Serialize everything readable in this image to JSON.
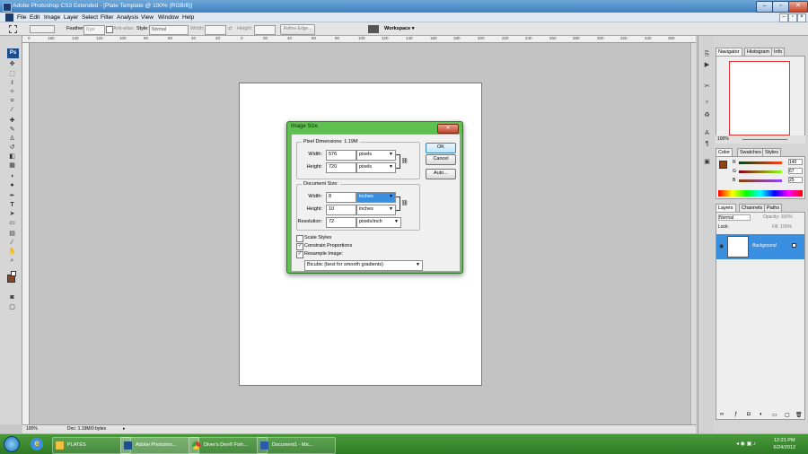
{
  "window": {
    "title": "Adobe Photoshop CS3 Extended - [Plate Template @ 100% (RGB/8)]"
  },
  "menubar": {
    "items": [
      "File",
      "Edit",
      "Image",
      "Layer",
      "Select",
      "Filter",
      "Analysis",
      "View",
      "Window",
      "Help"
    ]
  },
  "options_bar": {
    "feather_label": "Feather:",
    "feather_value": "0 px",
    "antialias_label": "Anti-alias",
    "style_label": "Style:",
    "style_value": "Normal",
    "width_label": "Width:",
    "height_label": "Height:",
    "refine_edge": "Refine Edge...",
    "workspace": "Workspace ▾"
  },
  "ruler": {
    "ticks": [
      "0",
      "160",
      "140",
      "120",
      "100",
      "80",
      "60",
      "40",
      "20",
      "0",
      "20",
      "40",
      "60",
      "80",
      "100",
      "120",
      "140",
      "160",
      "180",
      "200",
      "220",
      "240",
      "260",
      "280",
      "300",
      "320",
      "340",
      "360"
    ]
  },
  "status_bar": {
    "zoom": "100%",
    "doc": "Doc: 1.19M/0 bytes"
  },
  "panels": {
    "navigator_tabs": [
      "Navigator",
      "Histogram",
      "Info"
    ],
    "nav_zoom": "100%",
    "color_tabs": [
      "Color",
      "Swatches",
      "Styles"
    ],
    "color_channels": [
      {
        "label": "R",
        "value": "140"
      },
      {
        "label": "G",
        "value": "67"
      },
      {
        "label": "B",
        "value": "25"
      }
    ],
    "layers_tabs": [
      "Layers",
      "Channels",
      "Paths"
    ],
    "blend_mode": "Normal",
    "opacity": "Opacity: 100%",
    "lock_label": "Lock:",
    "fill": "Fill: 100%",
    "layer_name": "Background"
  },
  "dialog": {
    "title": "Image Size",
    "pixel_dimensions_label": "Pixel Dimensions:  1.19M",
    "px_width_label": "Width:",
    "px_width_value": "576",
    "px_width_unit": "pixels",
    "px_height_label": "Height:",
    "px_height_value": "720",
    "px_height_unit": "pixels",
    "document_size_label": "Document Size:",
    "doc_width_label": "Width:",
    "doc_width_value": "8",
    "doc_width_unit": "inches",
    "doc_height_label": "Height:",
    "doc_height_value": "10",
    "doc_height_unit": "inches",
    "resolution_label": "Resolution:",
    "resolution_value": "72",
    "resolution_unit": "pixels/inch",
    "scale_styles": "Scale Styles",
    "constrain": "Constrain Proportions",
    "resample": "Resample Image:",
    "resample_method": "Bicubic (best for smooth gradients)",
    "ok": "OK",
    "cancel": "Cancel",
    "auto": "Auto..."
  },
  "taskbar": {
    "items": [
      {
        "label": "PLATES"
      },
      {
        "label": "Adobe Photosho..."
      },
      {
        "label": "Diver's Den® Fish..."
      },
      {
        "label": "Document1 - Mic..."
      }
    ],
    "time": "12:21 PM",
    "date": "6/24/2012"
  },
  "colors": {
    "foreground": "#8c4319",
    "dialog_frame": "#5fbf4f",
    "taskbar": "#2f7a26",
    "selection": "#3a8fe0"
  }
}
